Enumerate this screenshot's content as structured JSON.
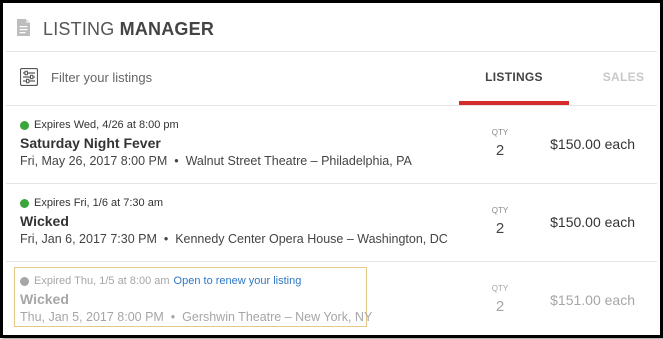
{
  "header": {
    "title_light": "LISTING ",
    "title_bold": "MANAGER",
    "icon": "document-icon"
  },
  "toolbar": {
    "filter_icon": "sliders-icon",
    "filter_placeholder": "Filter your listings",
    "tabs": [
      {
        "label": "LISTINGS",
        "active": true
      },
      {
        "label": "SALES",
        "active": false
      }
    ],
    "accent_color": "#d42b2b"
  },
  "listings": [
    {
      "status_text": "Expires Wed, 4/26 at 8:00 pm",
      "status_color": "#3aa53a",
      "renew_text": "",
      "event": "Saturday Night Fever",
      "date": "Fri, May 26, 2017 8:00 PM",
      "separator": "•",
      "venue": "Walnut Street Theatre – Philadelphia, PA",
      "qty_label": "QTY",
      "qty": "2",
      "price": "$150.00 each"
    },
    {
      "status_text": "Expires Fri, 1/6 at 7:30 am",
      "status_color": "#3aa53a",
      "renew_text": "",
      "event": "Wicked",
      "date": "Fri, Jan 6, 2017 7:30 PM",
      "separator": "•",
      "venue": "Kennedy Center Opera House – Washington, DC",
      "qty_label": "QTY",
      "qty": "2",
      "price": "$150.00 each"
    },
    {
      "status_text": "Expired Thu, 1/5 at 8:00 am",
      "status_color": "#a6a6a6",
      "renew_text": "Open to renew your listing",
      "event": "Wicked",
      "date": "Thu, Jan 5, 2017 8:00 PM",
      "separator": "•",
      "venue": "Gershwin Theatre – New York, NY",
      "qty_label": "QTY",
      "qty": "2",
      "price": "$151.00 each"
    }
  ]
}
